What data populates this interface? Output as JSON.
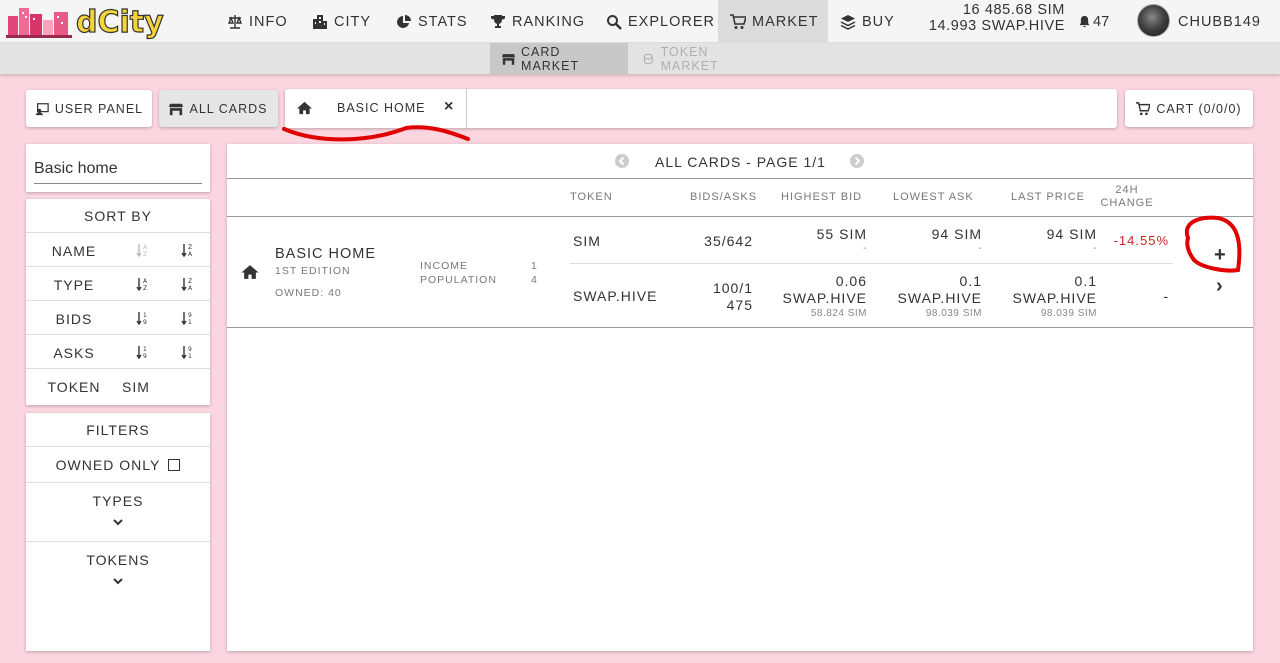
{
  "app": {
    "logo_text": "dCity"
  },
  "nav": [
    {
      "label": "INFO",
      "icon": "scale-icon"
    },
    {
      "label": "CITY",
      "icon": "city-icon"
    },
    {
      "label": "STATS",
      "icon": "pie-chart-icon"
    },
    {
      "label": "RANKING",
      "icon": "trophy-icon"
    },
    {
      "label": "EXPLORER",
      "icon": "search-icon"
    },
    {
      "label": "MARKET",
      "icon": "cart-icon",
      "active": true
    },
    {
      "label": "BUY",
      "icon": "layers-icon"
    }
  ],
  "balance": {
    "sim": "16 485.68 SIM",
    "swap_hive": "14.993 SWAP.HIVE"
  },
  "notifications": {
    "count": "47"
  },
  "user": {
    "name": "CHUBB149"
  },
  "subnav": {
    "card_market": "CARD MARKET",
    "token_market": "TOKEN MARKET"
  },
  "toolbar": {
    "user_panel": "USER PANEL",
    "all_cards": "ALL CARDS",
    "breadcrumb": "BASIC HOME",
    "breadcrumb_close": "×",
    "cart": "CART (0/0/0)"
  },
  "search": {
    "value": "Basic home"
  },
  "sort": {
    "title": "SORT BY",
    "rows": [
      "NAME",
      "TYPE",
      "BIDS",
      "ASKS"
    ],
    "token_label": "TOKEN",
    "token_value": "SIM"
  },
  "filters": {
    "title": "FILTERS",
    "owned_only": "OWNED ONLY",
    "types": "TYPES",
    "tokens": "TOKENS"
  },
  "pager": {
    "title": "ALL CARDS - PAGE 1/1"
  },
  "table": {
    "headers": {
      "token": "TOKEN",
      "bids_asks": "BIDS/ASKS",
      "highest_bid": "HIGHEST BID",
      "lowest_ask": "LOWEST ASK",
      "last_price": "LAST PRICE",
      "change_line1": "24H",
      "change_line2": "CHANGE"
    },
    "card": {
      "name": "BASIC HOME",
      "edition": "1ST EDITION",
      "owned": "OWNED: 40",
      "income_label": "INCOME",
      "income_value": "1",
      "population_label": "POPULATION",
      "population_value": "4",
      "add_symbol": "+",
      "expand_symbol": "›"
    },
    "rows": [
      {
        "token": "SIM",
        "bids_asks": "35/642",
        "highest_bid": "55 SIM",
        "highest_bid_sub": "-",
        "lowest_ask": "94 SIM",
        "lowest_ask_sub": "-",
        "last_price": "94 SIM",
        "last_price_sub": "-",
        "change": "-14.55%"
      },
      {
        "token": "SWAP.HIVE",
        "bids_asks_1": "100/1",
        "bids_asks_2": "475",
        "highest_bid_1": "0.06",
        "highest_bid_2": "SWAP.HIVE",
        "highest_bid_sub": "58.824 SIM",
        "lowest_ask_1": "0.1",
        "lowest_ask_2": "SWAP.HIVE",
        "lowest_ask_sub": "98.039 SIM",
        "last_price_1": "0.1",
        "last_price_2": "SWAP.HIVE",
        "last_price_sub": "98.039 SIM",
        "change": "-"
      }
    ]
  },
  "colors": {
    "background": "#fbd5e0",
    "negative": "#c62828",
    "annotation": "#e00000"
  }
}
